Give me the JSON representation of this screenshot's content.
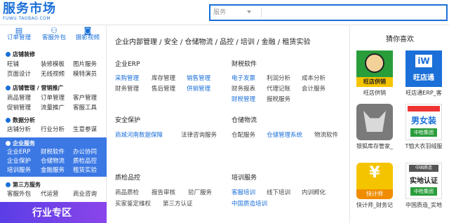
{
  "header": {
    "logo_text": "服务市场",
    "logo_sub": "FUWU.TAOBAO.COM",
    "search_select": "服务"
  },
  "quick_actions": [
    {
      "label": "订单管理",
      "icon": "order-icon"
    },
    {
      "label": "客服外包",
      "icon": "service-icon"
    },
    {
      "label": "摄影视频",
      "icon": "camera-icon"
    }
  ],
  "sidebar": {
    "sections": [
      {
        "title": "店铺装修",
        "items": [
          "旺铺",
          "装修模板",
          "图片服务",
          "页面设计",
          "无线视频",
          "模特演员"
        ]
      },
      {
        "title": "店铺管理 / 营销推广",
        "items": [
          "商品管理",
          "订单管理",
          "客户管理",
          "促销管理",
          "流量推广",
          "客服工具"
        ]
      },
      {
        "title": "数据分析",
        "items": [
          "店铺分析",
          "行业分析",
          "生意参谋"
        ]
      },
      {
        "title": "企业服务",
        "items": [
          "企业ERP",
          "财税软件",
          "办公协同",
          "企业保护",
          "仓储物流",
          "质检品控",
          "培训服务",
          "金融服务",
          "租赁实验"
        ]
      },
      {
        "title": "第三方服务",
        "items": [
          "客服外包",
          "代运营",
          "商业咨询"
        ]
      }
    ],
    "banner": "行业专区"
  },
  "main": {
    "breadcrumb": "企业内部管理 / 安全 / 仓储物流 / 品控 / 培训 / 金融 / 租赁实验",
    "categories": [
      {
        "title": "企业ERP",
        "links": [
          "采购管理",
          "库存管理",
          "销售管理",
          "财务管理",
          "售后管理",
          "供销管理"
        ]
      },
      {
        "title": "财税软件",
        "links": [
          "电子发票",
          "利润分析",
          "成本分析",
          "财务报表",
          "代理记账",
          "会计服务",
          "财税管理",
          "报税服务"
        ]
      },
      {
        "title": "安全保护",
        "links": [
          "商城河南数据保障",
          "法律咨询服务"
        ]
      },
      {
        "title": "仓储物流",
        "links": [
          "仓配服务",
          "仓储管理系统",
          "物流软件"
        ]
      },
      {
        "title": "质检品控",
        "links": [
          "商品质检",
          "报告审核",
          "验厂服务",
          "买家鉴定维权",
          "第三方认证"
        ]
      },
      {
        "title": "培训服务",
        "links": [
          "客服培训",
          "线下培训",
          "内训孵化",
          "中国质造培训"
        ]
      }
    ]
  },
  "recommend": {
    "title": "猜你喜欢",
    "items": [
      {
        "name": "旺店供销",
        "badge": "旺店供销"
      },
      {
        "name": "旺店通ERP_客",
        "badge": "旺店通"
      },
      {
        "name": "银狐库存管家_",
        "badge": ""
      },
      {
        "name": "T恤大衣羽绒服",
        "badge": "男女装"
      },
      {
        "name": "快计师_财务记",
        "badge": "快计师"
      },
      {
        "name": "中国质造_实地",
        "badge": "实地认证"
      }
    ],
    "colors": {
      "green": "#2a9d3b",
      "blue": "#1a6fd8",
      "gray": "#7a7a7a",
      "yellow": "#f5c400"
    }
  }
}
